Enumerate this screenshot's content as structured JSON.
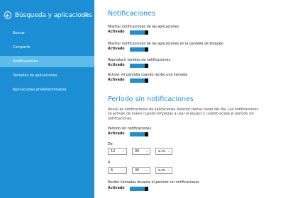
{
  "sidebar": {
    "title": "Búsqueda y aplicaciones",
    "items": [
      {
        "label": "Buscar"
      },
      {
        "label": "Compartir"
      },
      {
        "label": "Notificaciones"
      },
      {
        "label": "Tamaños de aplicaciones"
      },
      {
        "label": "Aplicaciones predeterminadas"
      }
    ],
    "selected_index": 2
  },
  "notifications": {
    "title": "Notificaciones",
    "settings": [
      {
        "label": "Mostrar notificaciones de las aplicaciones",
        "state": "Activado"
      },
      {
        "label": "Mostrar notificaciones de las aplicaciones en la pantalla de bloqueo",
        "state": "Activado"
      },
      {
        "label": "Reproducir sonidos de notificaciones",
        "state": "Activado"
      },
      {
        "label": "Activar mi pantalla cuando recibo una llamada",
        "state": "Activado"
      }
    ]
  },
  "quiet_hours": {
    "title": "Período sin notificaciones",
    "description": "Anula las notificaciones de aplicaciones durante ciertas horas del día. Las notificaciones se activan de nuevo cuando empiezas a usar el equipo o cuando acaba el período sin notificaciones.",
    "toggle": {
      "label": "Período sin notificaciones",
      "state": "Activado"
    },
    "from": {
      "label": "De",
      "hour": "12",
      "minute": "00",
      "ampm": "a.m."
    },
    "to": {
      "label": "A",
      "hour": "6",
      "minute": "00",
      "ampm": "a.m."
    },
    "calls": {
      "label": "Recibir llamadas durante el período sin notificaciones",
      "state": "Activado"
    }
  },
  "colors": {
    "accent": "#1b8ed4",
    "selected": "#5fbde9"
  }
}
